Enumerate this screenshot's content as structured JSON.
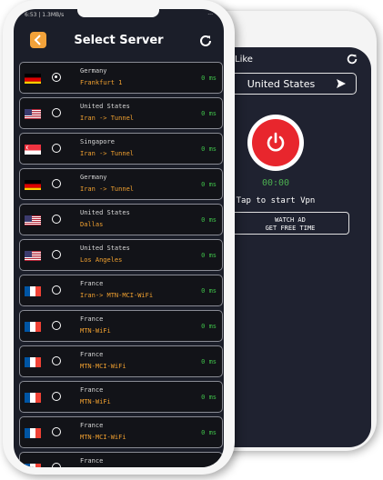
{
  "status_bar": {
    "time": "6:53 | 1.3MB/s",
    "right": "···"
  },
  "header": {
    "title": "Select Server"
  },
  "colors": {
    "background": "#1b1e29",
    "accent": "#f2a23a",
    "ping": "#3fc04a",
    "power": "#e8262d"
  },
  "servers": [
    {
      "flag": "germany",
      "country": "Germany",
      "city": "Frankfurt 1",
      "ping": "0 ms",
      "selected": true
    },
    {
      "flag": "usa",
      "country": "United States",
      "city": "Iran -> Tunnel",
      "ping": "0 ms",
      "selected": false
    },
    {
      "flag": "singapore",
      "country": "Singapore",
      "city": "Iran -> Tunnel",
      "ping": "0 ms",
      "selected": false
    },
    {
      "flag": "germany",
      "country": "Germany",
      "city": "Iran -> Tunnel",
      "ping": "0 ms",
      "selected": false
    },
    {
      "flag": "usa",
      "country": "United States",
      "city": "Dallas",
      "ping": "0 ms",
      "selected": false
    },
    {
      "flag": "usa",
      "country": "United States",
      "city": "Los Angeles",
      "ping": "0 ms",
      "selected": false
    },
    {
      "flag": "france",
      "country": "France",
      "city": "Iran-> MTN-MCI-WiFi",
      "ping": "0 ms",
      "selected": false
    },
    {
      "flag": "france",
      "country": "France",
      "city": "MTN-WiFi",
      "ping": "0 ms",
      "selected": false
    },
    {
      "flag": "france",
      "country": "France",
      "city": "MTN-MCI-WiFi",
      "ping": "0 ms",
      "selected": false
    },
    {
      "flag": "france",
      "country": "France",
      "city": "MTN-WiFi",
      "ping": "0 ms",
      "selected": false
    },
    {
      "flag": "france",
      "country": "France",
      "city": "MTN-MCI-WiFi",
      "ping": "0 ms",
      "selected": false
    },
    {
      "flag": "france",
      "country": "France",
      "city": "",
      "ping": "",
      "selected": false
    }
  ],
  "vpn_screen": {
    "title": "Like",
    "selected_country": "United States",
    "timer": "00:00",
    "tap_text": "Tap to start Vpn",
    "watch_ad_line1": "WATCH AD",
    "watch_ad_line2": "GET FREE TIME"
  }
}
